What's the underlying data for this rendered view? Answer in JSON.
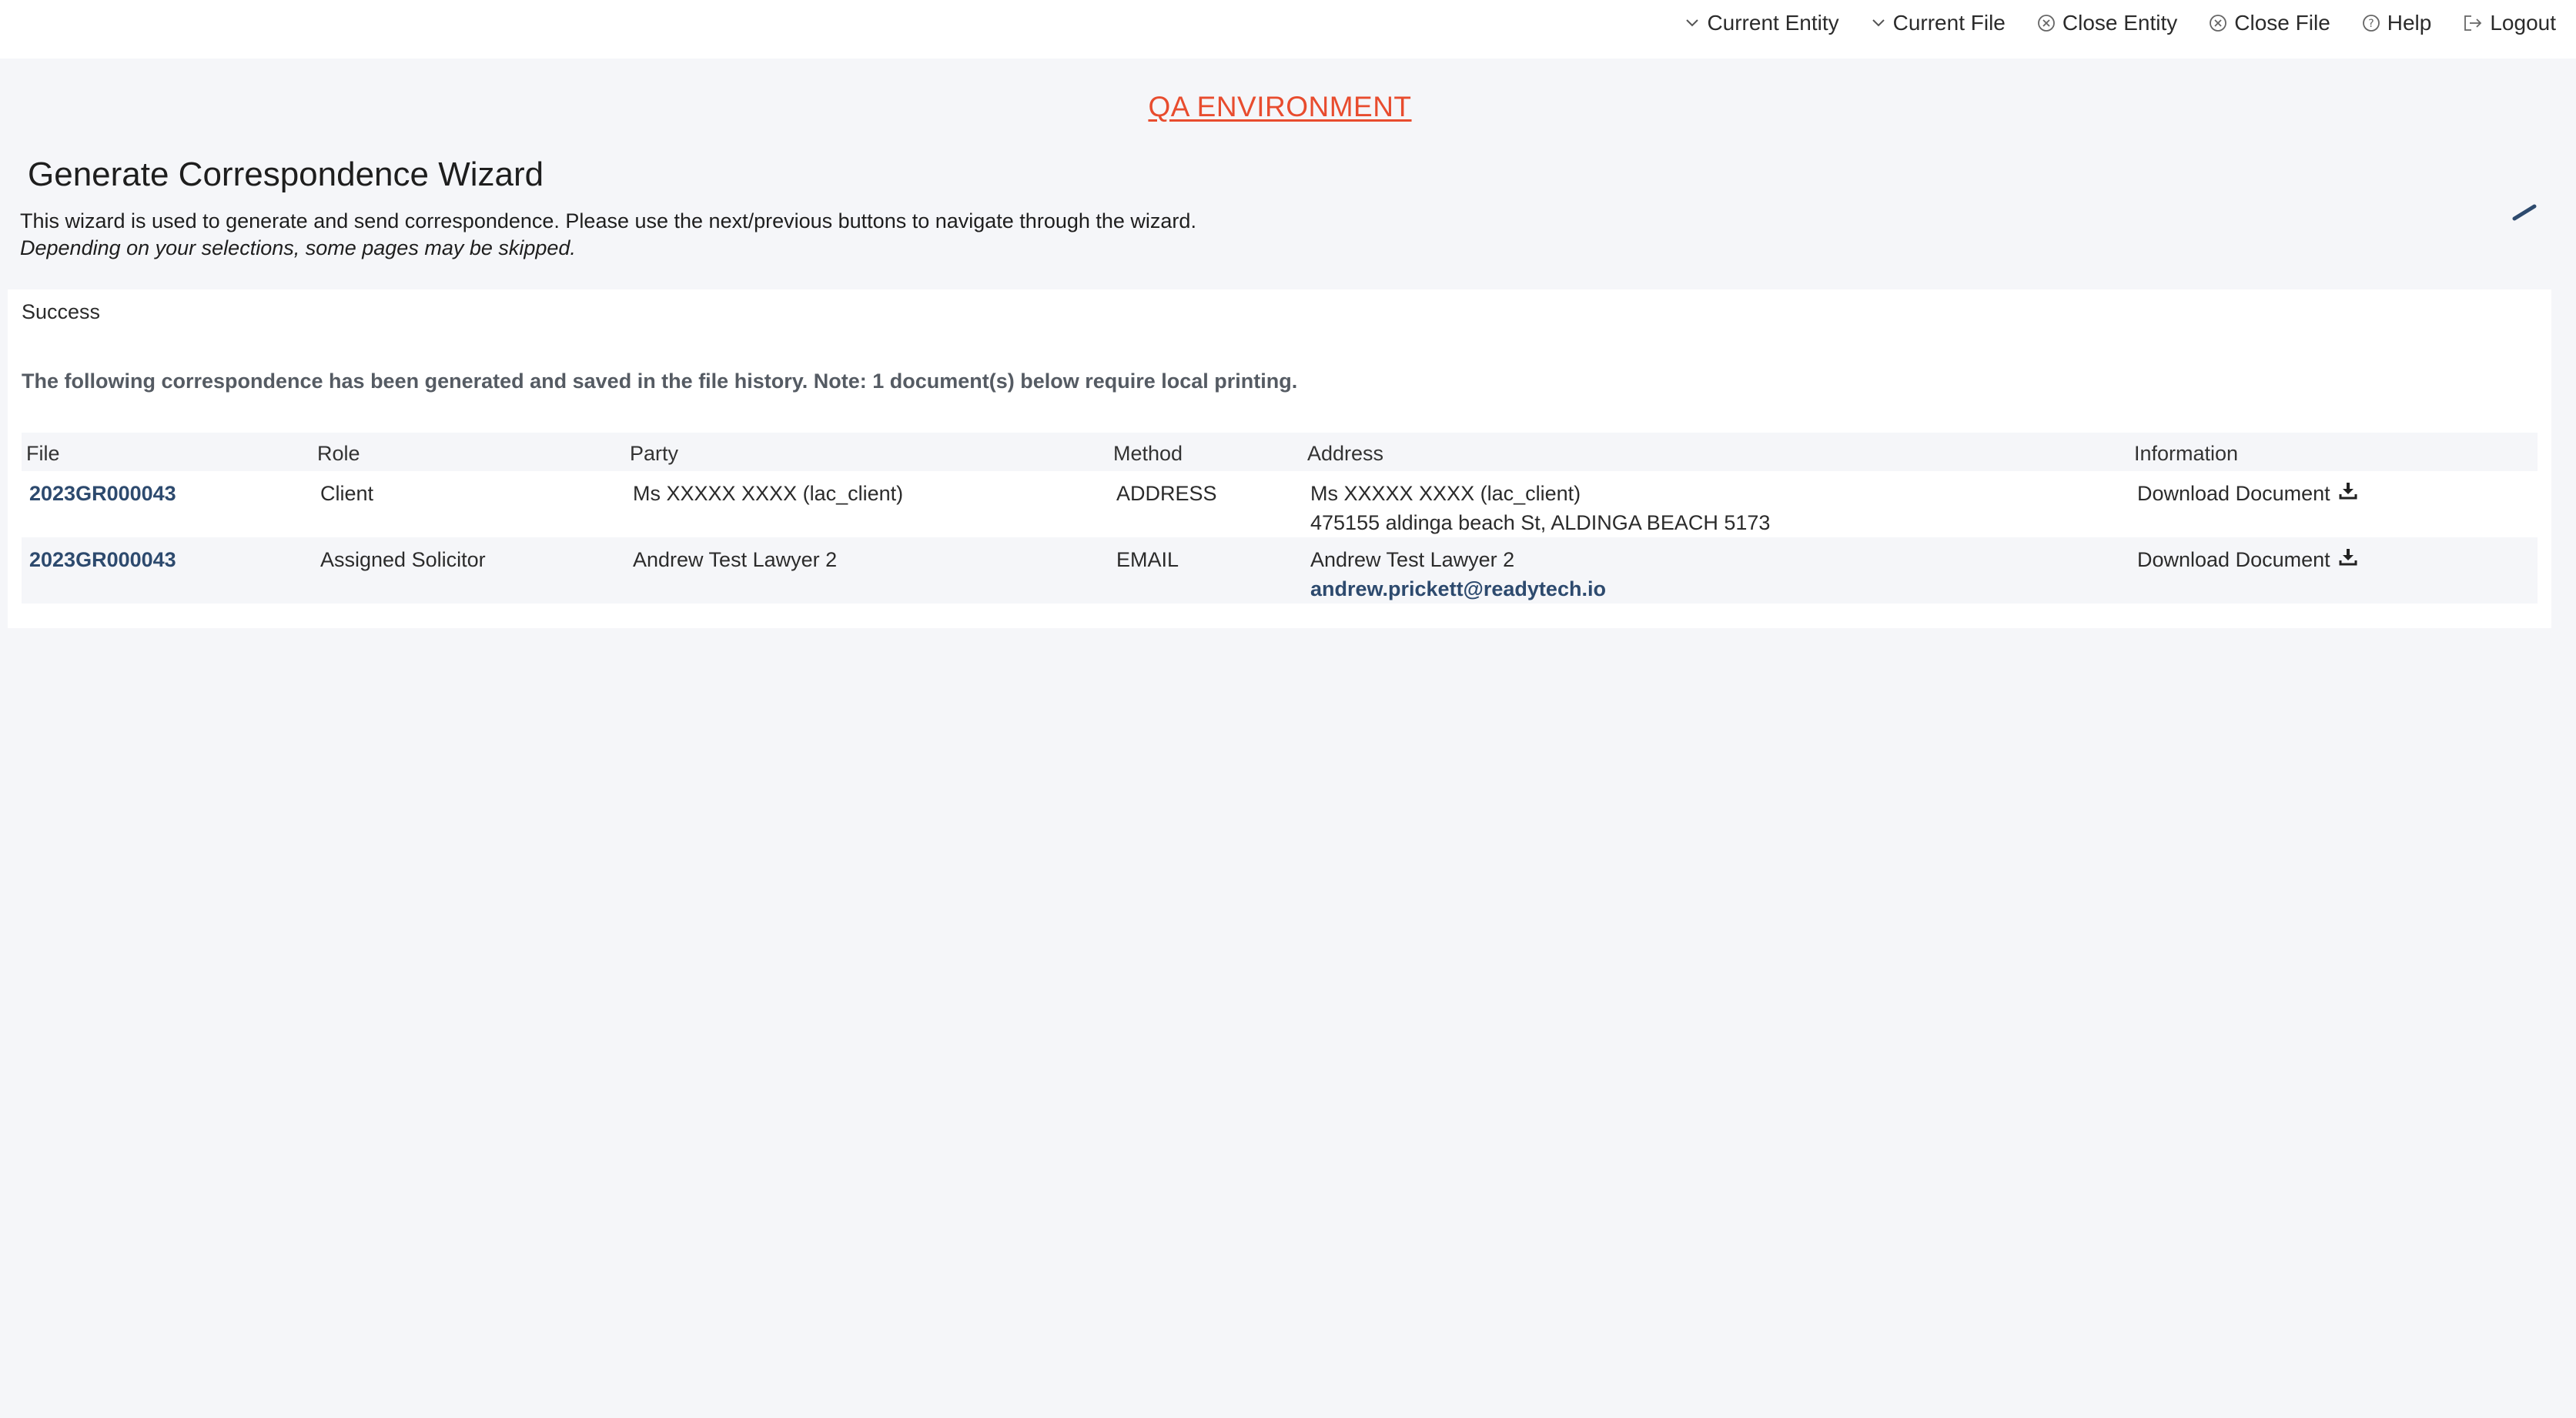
{
  "topnav": {
    "current_entity": "Current Entity",
    "current_file": "Current File",
    "close_entity": "Close Entity",
    "close_file": "Close File",
    "help": "Help",
    "logout": "Logout"
  },
  "environment_banner": "QA ENVIRONMENT",
  "wizard": {
    "title": "Generate Correspondence Wizard",
    "description": "This wizard is used to generate and send correspondence. Please use the next/previous buttons to navigate through the wizard.",
    "note": "Depending on your selections, some pages may be skipped."
  },
  "result": {
    "status": "Success",
    "message": "The following correspondence has been generated and saved in the file history. Note: 1 document(s) below require local printing.",
    "columns": [
      "File",
      "Role",
      "Party",
      "Method",
      "Address",
      "Information"
    ],
    "rows": [
      {
        "file": "2023GR000043",
        "role": "Client",
        "party": "Ms XXXXX XXXX (lac_client)",
        "method": "ADDRESS",
        "address_line1": "Ms XXXXX XXXX (lac_client)",
        "address_line2": "475155 aldinga beach St, ALDINGA BEACH 5173",
        "information": "Download Document"
      },
      {
        "file": "2023GR000043",
        "role": "Assigned Solicitor",
        "party": "Andrew Test Lawyer 2",
        "method": "EMAIL",
        "address_line1": "Andrew Test Lawyer 2",
        "address_line2": "andrew.prickett@readytech.io",
        "information": "Download Document"
      }
    ]
  },
  "colors": {
    "banner": "#e84c2e",
    "link": "#2d4a6e",
    "background": "#f5f6f9"
  }
}
